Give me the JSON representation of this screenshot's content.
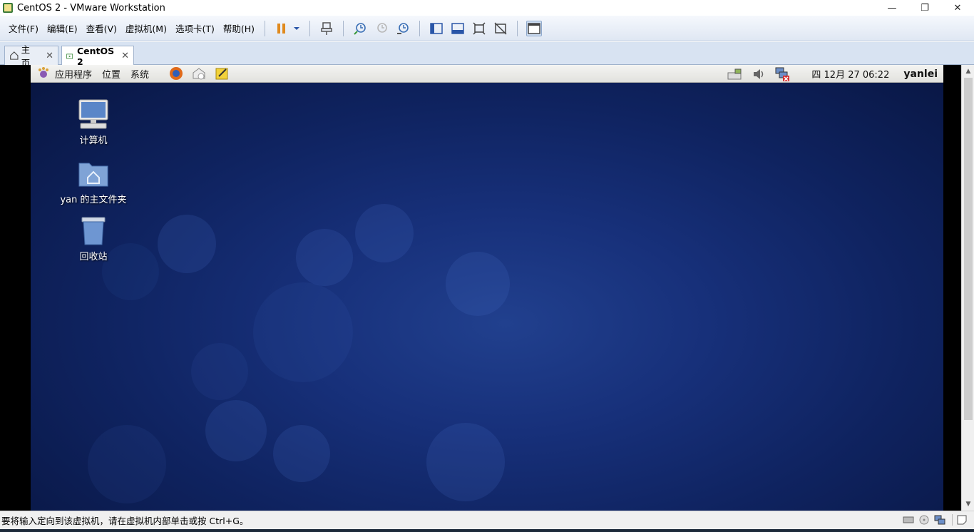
{
  "window": {
    "title": "CentOS 2 - VMware Workstation",
    "minimize_label": "—",
    "restore_label": "❐",
    "close_label": "✕"
  },
  "menu": {
    "items": [
      "文件(F)",
      "编辑(E)",
      "查看(V)",
      "虚拟机(M)",
      "选项卡(T)",
      "帮助(H)"
    ]
  },
  "tabs": [
    {
      "label": "主页",
      "close": "✕"
    },
    {
      "label": "CentOS 2",
      "close": "✕"
    }
  ],
  "guest_panel": {
    "applications": "应用程序",
    "places": "位置",
    "system": "系统",
    "clock": "四 12月 27 06:22",
    "user": "yanlei"
  },
  "desktop_icons": [
    {
      "label": "计算机",
      "icon": "computer-icon"
    },
    {
      "label": "yan 的主文件夹",
      "icon": "home-folder-icon"
    },
    {
      "label": "回收站",
      "icon": "trash-icon"
    }
  ],
  "statusbar": {
    "text": "要将输入定向到该虚拟机，请在虚拟机内部单击或按 Ctrl+G。"
  },
  "colors": {
    "pause_accent": "#e08a1e",
    "desktop_base": "#12286a"
  }
}
